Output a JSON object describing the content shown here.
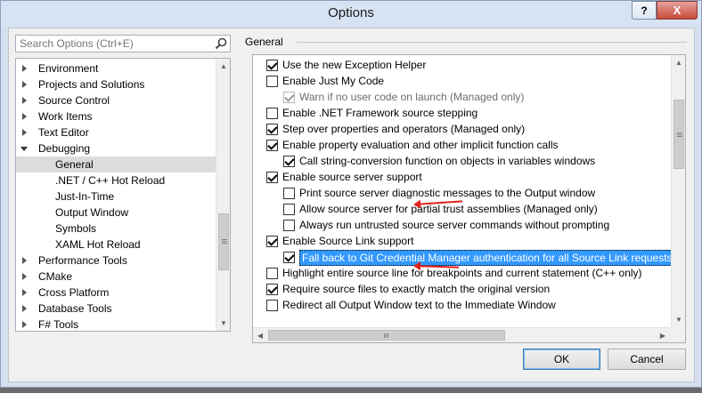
{
  "window": {
    "title": "Options",
    "help_label": "?",
    "close_label": "X"
  },
  "search": {
    "placeholder": "Search Options (Ctrl+E)",
    "icon": "search-icon"
  },
  "tree": {
    "items": [
      {
        "label": "Environment",
        "level": 0,
        "expander": "closed"
      },
      {
        "label": "Projects and Solutions",
        "level": 0,
        "expander": "closed"
      },
      {
        "label": "Source Control",
        "level": 0,
        "expander": "closed"
      },
      {
        "label": "Work Items",
        "level": 0,
        "expander": "closed"
      },
      {
        "label": "Text Editor",
        "level": 0,
        "expander": "closed"
      },
      {
        "label": "Debugging",
        "level": 0,
        "expander": "open"
      },
      {
        "label": "General",
        "level": 1,
        "selected": true
      },
      {
        "label": ".NET / C++ Hot Reload",
        "level": 1
      },
      {
        "label": "Just-In-Time",
        "level": 1
      },
      {
        "label": "Output Window",
        "level": 1
      },
      {
        "label": "Symbols",
        "level": 1
      },
      {
        "label": "XAML Hot Reload",
        "level": 1
      },
      {
        "label": "Performance Tools",
        "level": 0,
        "expander": "closed"
      },
      {
        "label": "CMake",
        "level": 0,
        "expander": "closed"
      },
      {
        "label": "Cross Platform",
        "level": 0,
        "expander": "closed"
      },
      {
        "label": "Database Tools",
        "level": 0,
        "expander": "closed"
      },
      {
        "label": "F# Tools",
        "level": 0,
        "expander": "closed"
      }
    ]
  },
  "group": {
    "label": "General"
  },
  "options": [
    {
      "label": "Use the new Exception Helper",
      "checked": true,
      "level": 0
    },
    {
      "label": "Enable Just My Code",
      "checked": false,
      "level": 0
    },
    {
      "label": "Warn if no user code on launch (Managed only)",
      "checked": true,
      "level": 1,
      "disabled": true
    },
    {
      "label": "Enable .NET Framework source stepping",
      "checked": false,
      "level": 0
    },
    {
      "label": "Step over properties and operators (Managed only)",
      "checked": true,
      "level": 0
    },
    {
      "label": "Enable property evaluation and other implicit function calls",
      "checked": true,
      "level": 0
    },
    {
      "label": "Call string-conversion function on objects in variables windows",
      "checked": true,
      "level": 1
    },
    {
      "label": "Enable source server support",
      "checked": true,
      "level": 0
    },
    {
      "label": "Print source server diagnostic messages to the Output window",
      "checked": false,
      "level": 1
    },
    {
      "label": "Allow source server for partial trust assemblies (Managed only)",
      "checked": false,
      "level": 1
    },
    {
      "label": "Always run untrusted source server commands without prompting",
      "checked": false,
      "level": 1
    },
    {
      "label": "Enable Source Link support",
      "checked": true,
      "level": 0
    },
    {
      "label": "Fall back to Git Credential Manager authentication for all Source Link requests",
      "checked": true,
      "level": 1,
      "highlighted": true
    },
    {
      "label": "Highlight entire source line for breakpoints and current statement (C++ only)",
      "checked": false,
      "level": 0
    },
    {
      "label": "Require source files to exactly match the original version",
      "checked": true,
      "level": 0
    },
    {
      "label": "Redirect all Output Window text to the Immediate Window",
      "checked": false,
      "level": 0
    }
  ],
  "buttons": {
    "ok_label": "OK",
    "cancel_label": "Cancel"
  },
  "colors": {
    "annotation_arrow": "#e0201a",
    "selection": "#3399ff"
  }
}
